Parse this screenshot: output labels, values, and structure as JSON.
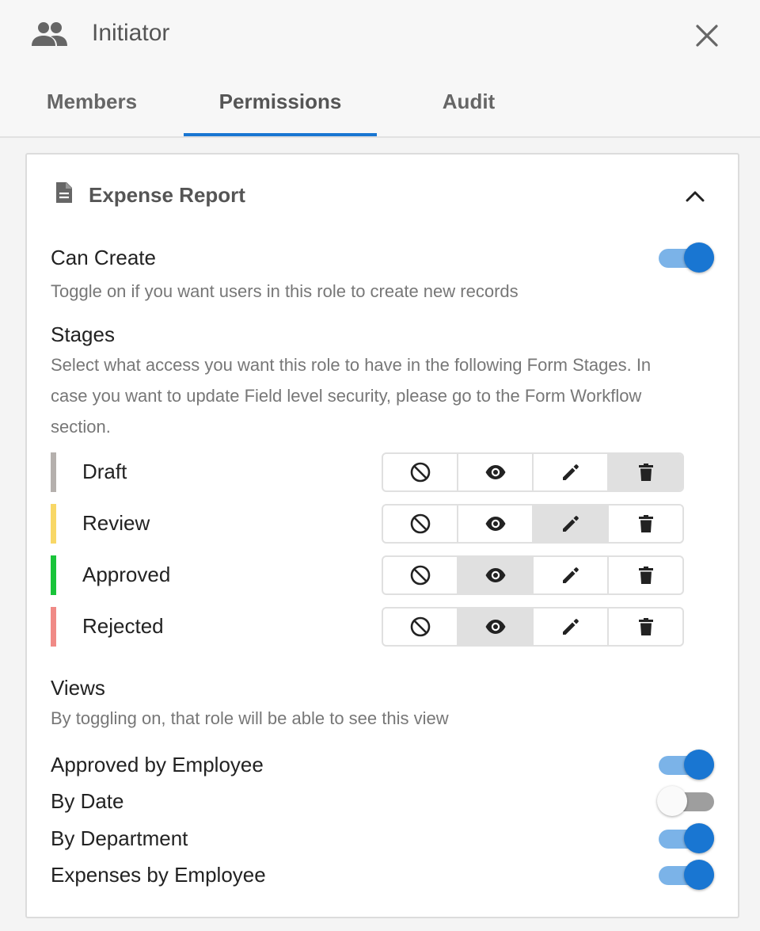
{
  "header": {
    "title": "Initiator",
    "icon": "people-icon",
    "close_icon": "close-icon"
  },
  "tabs": [
    {
      "label": "Members",
      "active": false
    },
    {
      "label": "Permissions",
      "active": true
    },
    {
      "label": "Audit",
      "active": false
    }
  ],
  "colors": {
    "accent": "#1976d2",
    "draft": "#b5b0ad",
    "review": "#f8d766",
    "approved": "#19c43a",
    "rejected": "#f08a86"
  },
  "form": {
    "title": "Expense Report",
    "icon": "document-icon",
    "can_create": {
      "label": "Can Create",
      "description": "Toggle on if you want users in this role to create new records",
      "enabled": true
    },
    "stages": {
      "label": "Stages",
      "description_lines": [
        "Select what access you want this role to have in the following Form Stages. In",
        "case you want to update Field level security, please go to the Form Workflow",
        "section."
      ],
      "access_options": [
        "no-access-icon",
        "view-icon",
        "edit-icon",
        "delete-icon"
      ],
      "items": [
        {
          "name": "Draft",
          "color": "#b5b0ad",
          "selected": "delete"
        },
        {
          "name": "Review",
          "color": "#f8d766",
          "selected": "edit"
        },
        {
          "name": "Approved",
          "color": "#19c43a",
          "selected": "view"
        },
        {
          "name": "Rejected",
          "color": "#f08a86",
          "selected": "view"
        }
      ]
    },
    "views": {
      "label": "Views",
      "description": "By toggling on, that role will be able to see this view",
      "items": [
        {
          "name": "Approved by Employee",
          "enabled": true
        },
        {
          "name": "By Date",
          "enabled": false
        },
        {
          "name": "By Department",
          "enabled": true
        },
        {
          "name": "Expenses by Employee",
          "enabled": true
        }
      ]
    }
  }
}
